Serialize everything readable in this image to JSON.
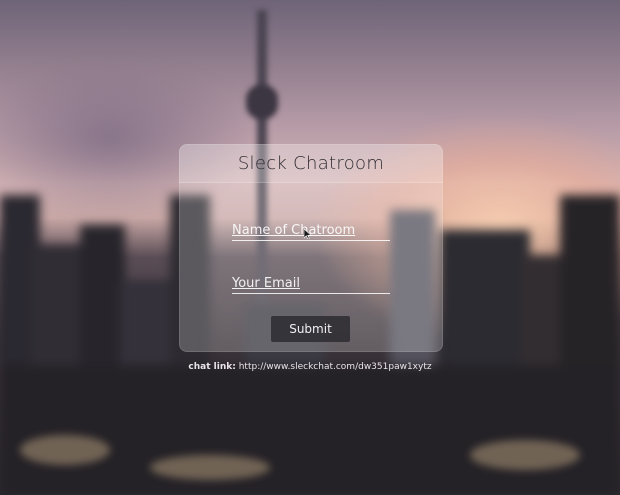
{
  "form": {
    "title": "Sleck Chatroom",
    "name_placeholder": "Name of Chatroom",
    "email_placeholder": "Your Email",
    "submit_label": "Submit"
  },
  "chat_link": {
    "label": "chat link:",
    "url": "http://www.sleckchat.com/dw351paw1xytz"
  },
  "colors": {
    "card_background": "#ffffff33",
    "button_background": "#28262c",
    "text_light": "#ffffff",
    "title_text": "#2e2a30"
  },
  "icons": {
    "cursor": "mouse-pointer-icon"
  }
}
